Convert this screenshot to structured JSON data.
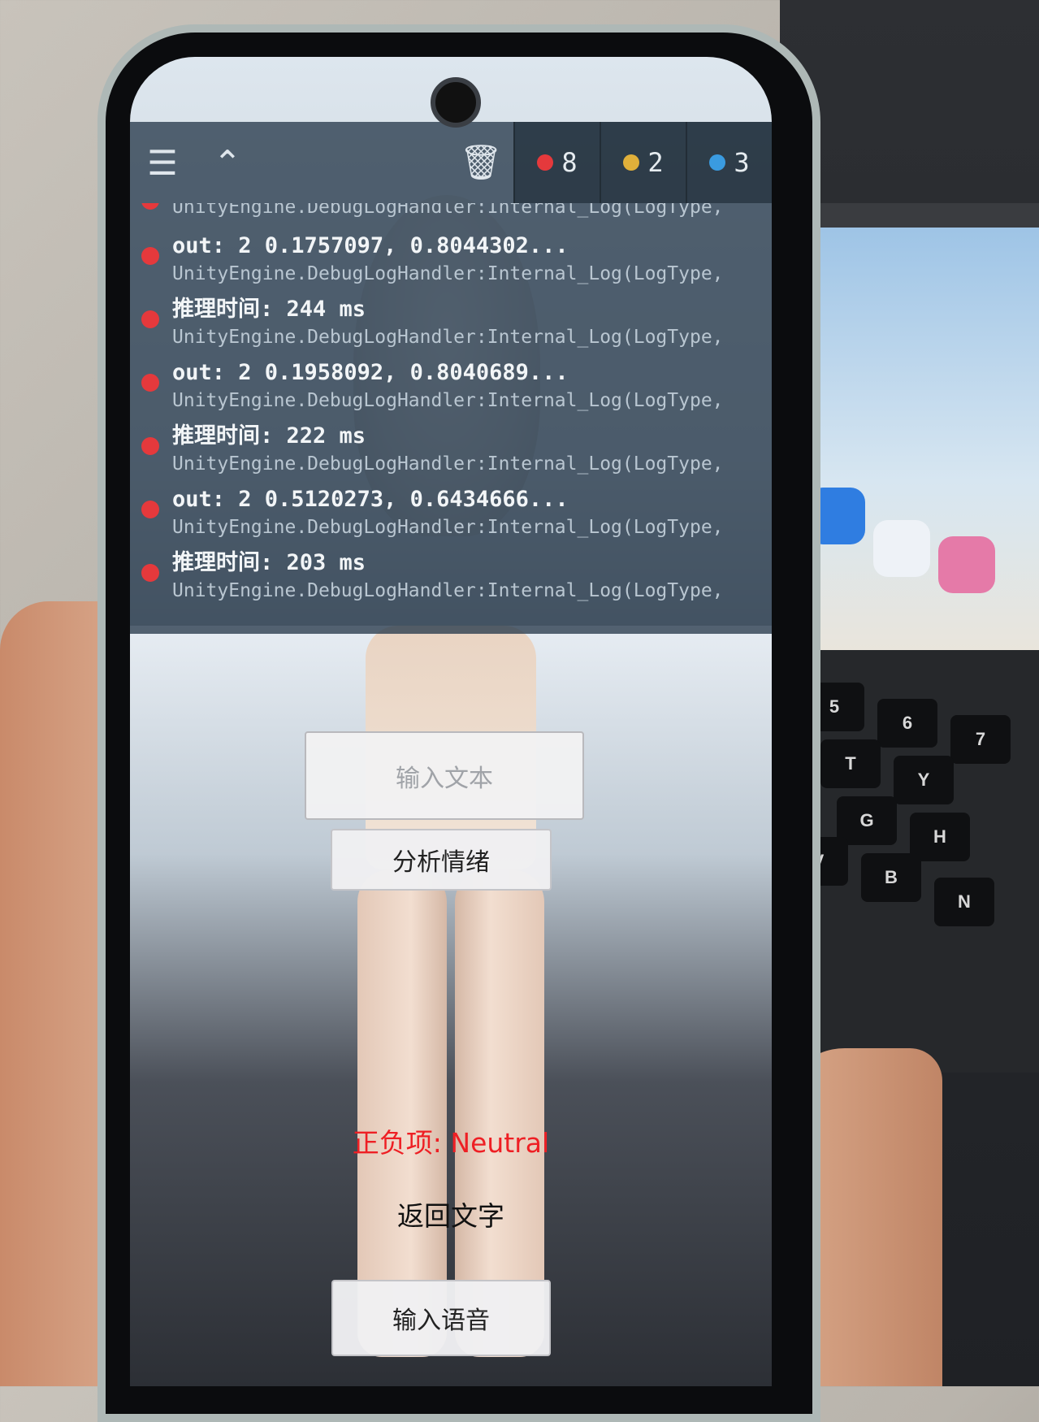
{
  "console": {
    "toolbar": {
      "menu_icon": "hamburger-icon",
      "collapse_icon": "chevron-up-icon",
      "clear_icon": "trash-icon",
      "error_count": "8",
      "warning_count": "2",
      "info_count": "3",
      "error_color": "#e5393c",
      "warning_color": "#e0b03a",
      "info_color": "#3a9be0"
    },
    "entries": [
      {
        "message": "",
        "stack": "UnityEngine.DebugLogHandler:Internal_Log(LogType,"
      },
      {
        "message": "out: 2  0.1757097, 0.8044302...",
        "stack": "UnityEngine.DebugLogHandler:Internal_Log(LogType,"
      },
      {
        "message": "推理时间: 244 ms",
        "stack": "UnityEngine.DebugLogHandler:Internal_Log(LogType,"
      },
      {
        "message": "out: 2  0.1958092, 0.8040689...",
        "stack": "UnityEngine.DebugLogHandler:Internal_Log(LogType,"
      },
      {
        "message": "推理时间: 222 ms",
        "stack": "UnityEngine.DebugLogHandler:Internal_Log(LogType,"
      },
      {
        "message": "out: 2  0.5120273, 0.6434666...",
        "stack": "UnityEngine.DebugLogHandler:Internal_Log(LogType,"
      },
      {
        "message": "推理时间: 203 ms",
        "stack": "UnityEngine.DebugLogHandler:Internal_Log(LogType,"
      }
    ]
  },
  "app": {
    "text_input_placeholder": "输入文本",
    "analyze_button": "分析情绪",
    "sentiment_label": "正负项: Neutral",
    "return_text_label": "返回文字",
    "voice_button": "输入语音",
    "sentiment_color": "#ee1f24"
  },
  "laptop": {
    "keys": [
      "5",
      "6",
      "7",
      "T",
      "Y",
      "G",
      "H",
      "V",
      "B",
      "N"
    ]
  }
}
